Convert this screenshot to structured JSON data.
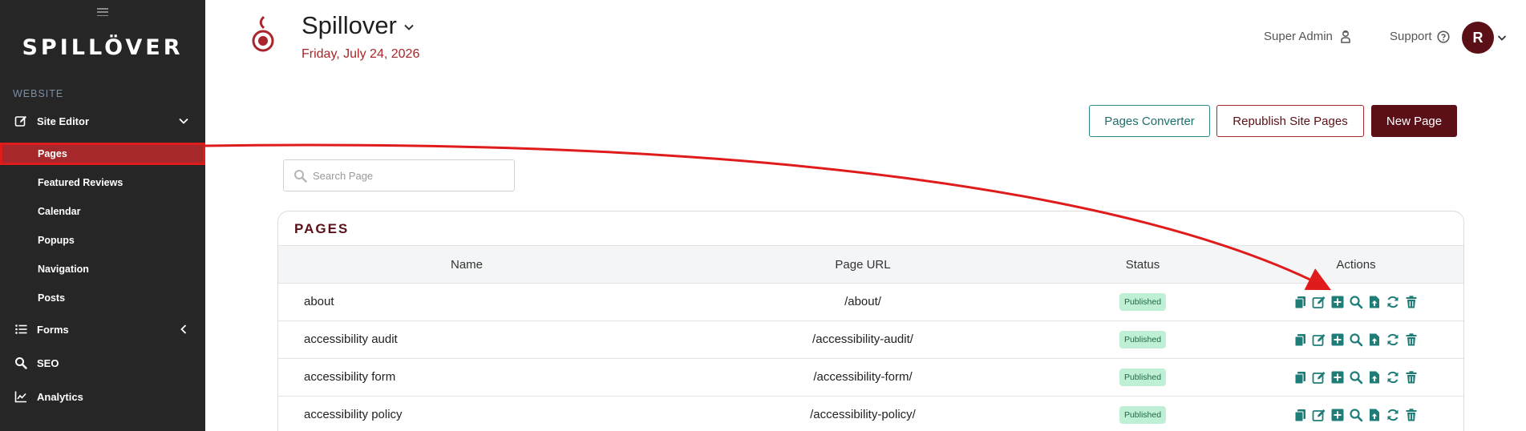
{
  "sidebar": {
    "logo": "SPILLÖVER",
    "section_label": "WEBSITE",
    "site_editor": {
      "label": "Site Editor"
    },
    "sub_items": [
      {
        "label": "Pages"
      },
      {
        "label": "Featured Reviews"
      },
      {
        "label": "Calendar"
      },
      {
        "label": "Popups"
      },
      {
        "label": "Navigation"
      },
      {
        "label": "Posts"
      }
    ],
    "forms": {
      "label": "Forms"
    },
    "seo": {
      "label": "SEO"
    },
    "analytics": {
      "label": "Analytics"
    }
  },
  "header": {
    "title": "Spillover",
    "date": "Friday, July 24, 2026",
    "super_admin": "Super Admin",
    "support": "Support",
    "avatar_initial": "R"
  },
  "toolbar": {
    "converter_label": "Pages Converter",
    "republish_label": "Republish Site Pages",
    "new_page_label": "New Page"
  },
  "search": {
    "placeholder": "Search Page",
    "value": ""
  },
  "pages_table": {
    "title": "PAGES",
    "columns": [
      "Name",
      "Page URL",
      "Status",
      "Actions"
    ],
    "rows": [
      {
        "name": "about",
        "url": "/about/",
        "status": "Published"
      },
      {
        "name": "accessibility audit",
        "url": "/accessibility-audit/",
        "status": "Published"
      },
      {
        "name": "accessibility form",
        "url": "/accessibility-form/",
        "status": "Published"
      },
      {
        "name": "accessibility policy",
        "url": "/accessibility-policy/",
        "status": "Published"
      }
    ],
    "action_icons": [
      "copy-icon",
      "edit-icon",
      "add-icon",
      "search-icon",
      "upload-file-icon",
      "refresh-icon",
      "trash-icon"
    ]
  },
  "colors": {
    "sidebar_bg": "#262626",
    "brand_dark": "#5a1016",
    "brand_red": "#a8262b",
    "teal": "#1f7d78",
    "badge_bg": "#bff0d6",
    "highlight_red": "#e01b1b"
  }
}
